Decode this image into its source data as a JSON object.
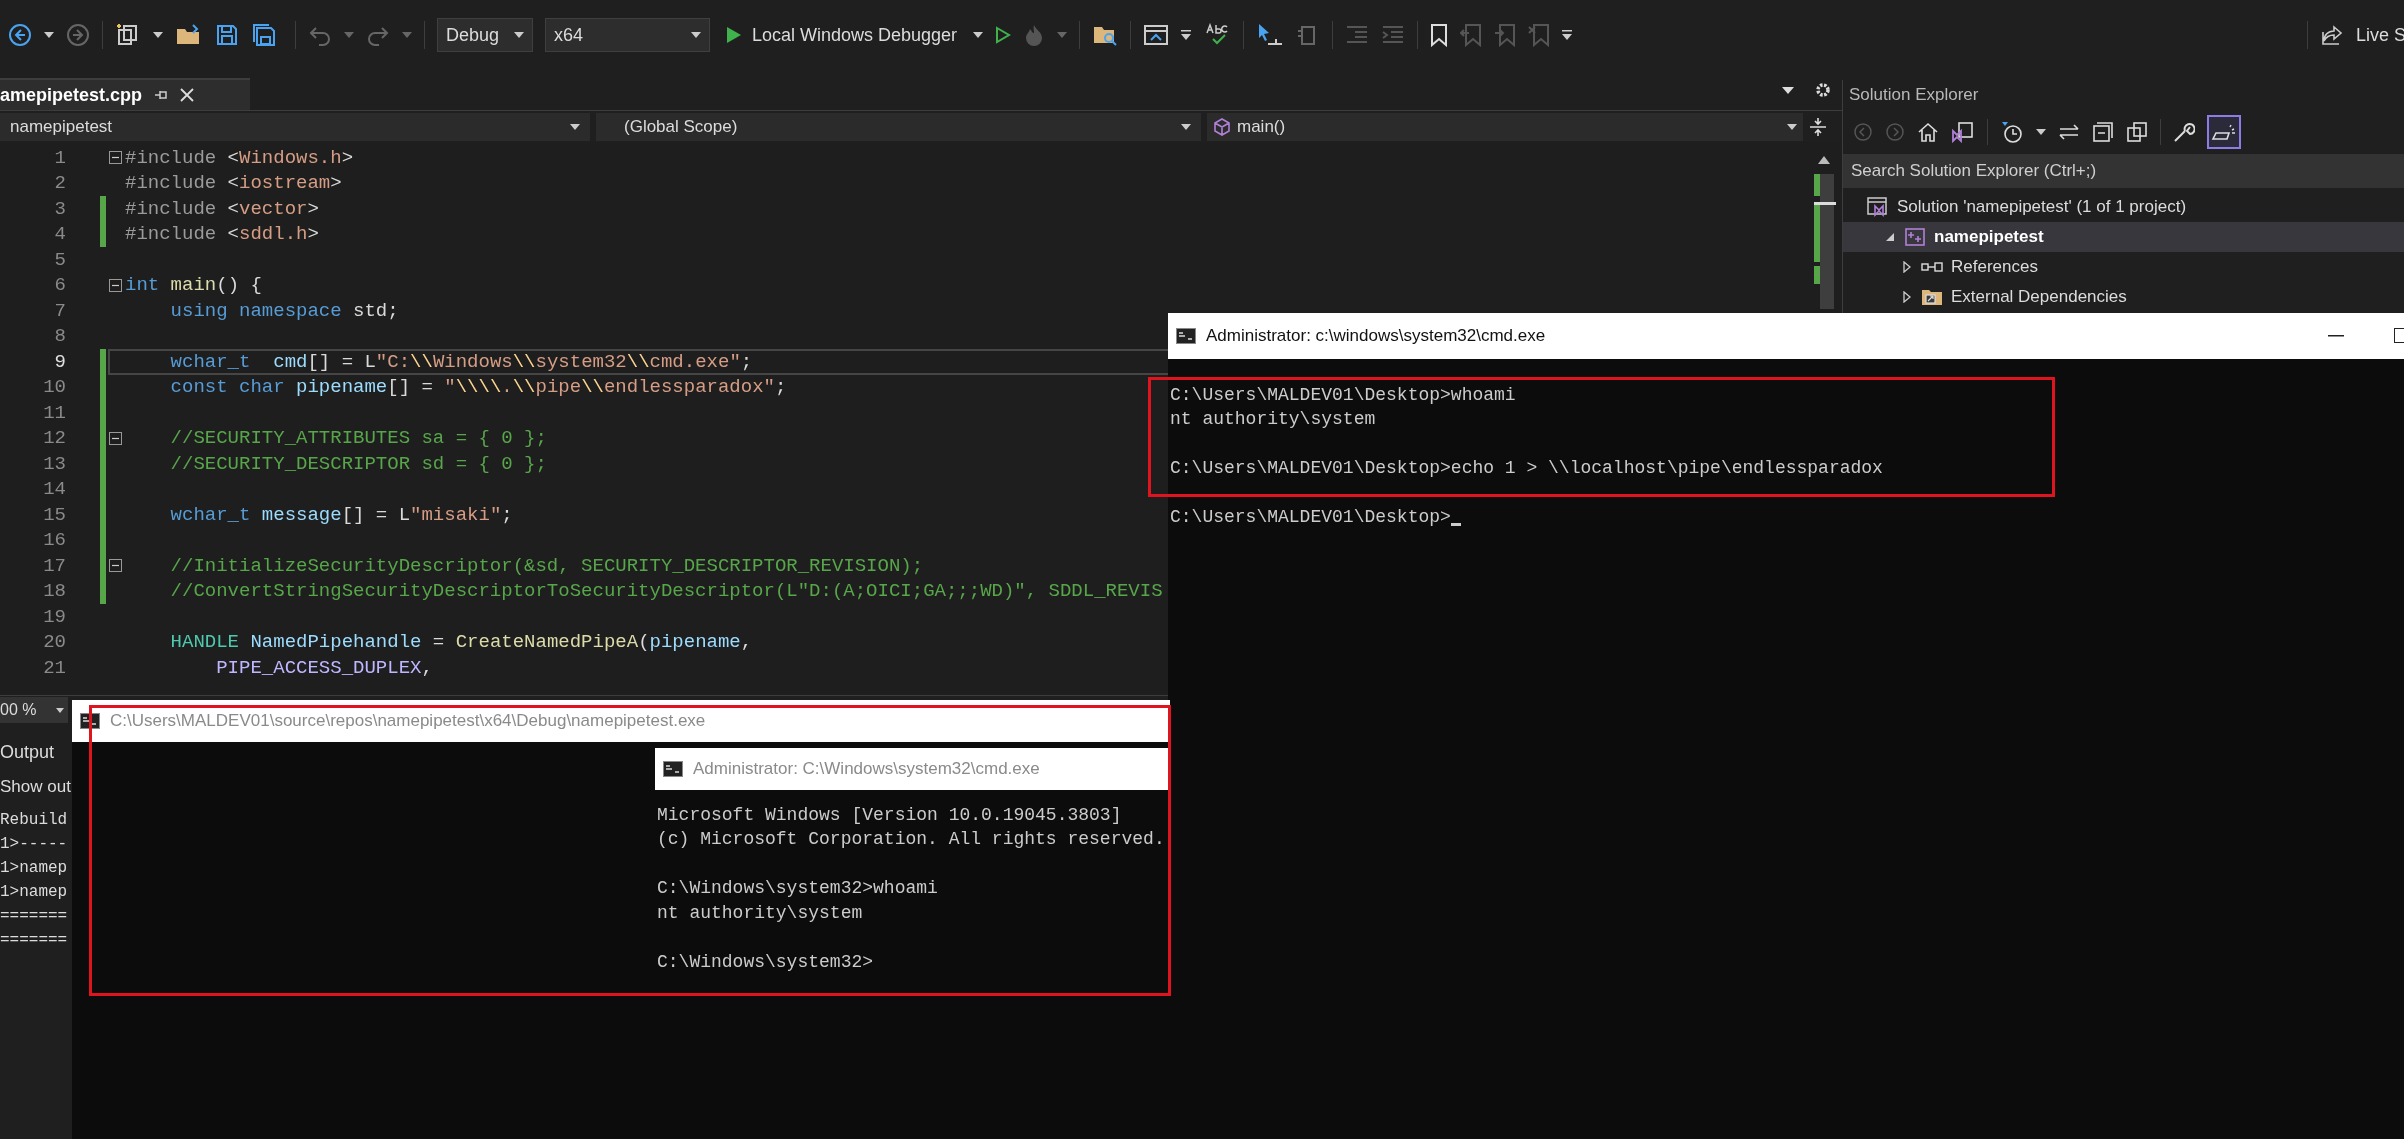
{
  "toolbar": {
    "configuration": "Debug",
    "platform": "x64",
    "debugger": "Local Windows Debugger",
    "live_share": "Live S"
  },
  "editor": {
    "tab": "amepipetest.cpp",
    "nav": {
      "project": "namepipetest",
      "scope": "(Global Scope)",
      "member": "main()"
    },
    "lines": [
      {
        "number": "1",
        "changed": false,
        "fold": true,
        "current": false,
        "tokens": [
          {
            "text": "#include",
            "kind": "pre"
          },
          {
            "text": " <",
            "kind": "plain"
          },
          {
            "text": "Windows.h",
            "kind": "str"
          },
          {
            "text": ">",
            "kind": "plain"
          }
        ]
      },
      {
        "number": "2",
        "changed": false,
        "fold": false,
        "current": false,
        "tokens": [
          {
            "text": "#include",
            "kind": "pre"
          },
          {
            "text": " <",
            "kind": "plain"
          },
          {
            "text": "iostream",
            "kind": "str"
          },
          {
            "text": ">",
            "kind": "plain"
          }
        ]
      },
      {
        "number": "3",
        "changed": true,
        "fold": false,
        "current": false,
        "tokens": [
          {
            "text": "#include",
            "kind": "pre"
          },
          {
            "text": " <",
            "kind": "plain"
          },
          {
            "text": "vector",
            "kind": "str"
          },
          {
            "text": ">",
            "kind": "plain"
          }
        ]
      },
      {
        "number": "4",
        "changed": true,
        "fold": false,
        "current": false,
        "tokens": [
          {
            "text": "#include",
            "kind": "pre"
          },
          {
            "text": " <",
            "kind": "plain"
          },
          {
            "text": "sddl.h",
            "kind": "str"
          },
          {
            "text": ">",
            "kind": "plain"
          }
        ]
      },
      {
        "number": "5",
        "changed": false,
        "fold": false,
        "current": false
      },
      {
        "number": "6",
        "changed": false,
        "fold": true,
        "current": false,
        "tokens": [
          {
            "text": "int",
            "kind": "kw"
          },
          {
            "text": " main",
            "kind": "func"
          },
          {
            "text": "() {",
            "kind": "plain"
          }
        ]
      },
      {
        "number": "7",
        "changed": false,
        "fold": false,
        "current": false,
        "tokens": [
          {
            "text": "    using namespace",
            "kind": "kw"
          },
          {
            "text": " std;",
            "kind": "plain"
          }
        ]
      },
      {
        "number": "8",
        "changed": false,
        "fold": false,
        "current": false
      },
      {
        "number": "9",
        "changed": true,
        "fold": false,
        "current": true,
        "tokens": [
          {
            "text": "    wchar_t",
            "kind": "kw"
          },
          {
            "text": "  cmd",
            "kind": "var"
          },
          {
            "text": "[] = L",
            "kind": "plain"
          },
          {
            "text": "\"C:",
            "kind": "str"
          },
          {
            "text": "\\\\",
            "kind": "esc"
          },
          {
            "text": "Windows",
            "kind": "str"
          },
          {
            "text": "\\\\",
            "kind": "esc"
          },
          {
            "text": "system32",
            "kind": "str"
          },
          {
            "text": "\\\\",
            "kind": "esc"
          },
          {
            "text": "cmd.exe\"",
            "kind": "str"
          },
          {
            "text": ";",
            "kind": "plain"
          }
        ]
      },
      {
        "number": "10",
        "changed": true,
        "fold": false,
        "current": false,
        "tokens": [
          {
            "text": "    const char",
            "kind": "kw"
          },
          {
            "text": " pipename",
            "kind": "var"
          },
          {
            "text": "[] = ",
            "kind": "plain"
          },
          {
            "text": "\"",
            "kind": "str"
          },
          {
            "text": "\\\\\\\\",
            "kind": "esc"
          },
          {
            "text": ".",
            "kind": "str"
          },
          {
            "text": "\\\\",
            "kind": "esc"
          },
          {
            "text": "pipe",
            "kind": "str"
          },
          {
            "text": "\\\\",
            "kind": "esc"
          },
          {
            "text": "endlessparadox\"",
            "kind": "str"
          },
          {
            "text": ";",
            "kind": "plain"
          }
        ]
      },
      {
        "number": "11",
        "changed": true,
        "fold": false,
        "current": false
      },
      {
        "number": "12",
        "changed": true,
        "fold": true,
        "current": false,
        "tokens": [
          {
            "text": "    //SECURITY_ATTRIBUTES sa = { 0 };",
            "kind": "com"
          }
        ]
      },
      {
        "number": "13",
        "changed": true,
        "fold": false,
        "current": false,
        "tokens": [
          {
            "text": "    //SECURITY_DESCRIPTOR sd = { 0 };",
            "kind": "com"
          }
        ]
      },
      {
        "number": "14",
        "changed": true,
        "fold": false,
        "current": false
      },
      {
        "number": "15",
        "changed": true,
        "fold": false,
        "current": false,
        "tokens": [
          {
            "text": "    wchar_t",
            "kind": "kw"
          },
          {
            "text": " message",
            "kind": "var"
          },
          {
            "text": "[] = L",
            "kind": "plain"
          },
          {
            "text": "\"misaki\"",
            "kind": "str"
          },
          {
            "text": ";",
            "kind": "plain"
          }
        ]
      },
      {
        "number": "16",
        "changed": true,
        "fold": false,
        "current": false
      },
      {
        "number": "17",
        "changed": true,
        "fold": true,
        "current": false,
        "tokens": [
          {
            "text": "    //InitializeSecurityDescriptor(&sd, SECURITY_DESCRIPTOR_REVISION);",
            "kind": "com"
          }
        ]
      },
      {
        "number": "18",
        "changed": true,
        "fold": false,
        "current": false,
        "tokens": [
          {
            "text": "    //ConvertStringSecurityDescriptorToSecurityDescriptor(L\"D:(A;OICI;GA;;;WD)\", SDDL_REVIS",
            "kind": "com"
          }
        ]
      },
      {
        "number": "19",
        "changed": false,
        "fold": false,
        "current": false
      },
      {
        "number": "20",
        "changed": false,
        "fold": false,
        "current": false,
        "tokens": [
          {
            "text": "    HANDLE",
            "kind": "type"
          },
          {
            "text": " NamedPipehandle",
            "kind": "var"
          },
          {
            "text": " = ",
            "kind": "plain"
          },
          {
            "text": "CreateNamedPipeA",
            "kind": "func"
          },
          {
            "text": "(",
            "kind": "plain"
          },
          {
            "text": "pipename",
            "kind": "var"
          },
          {
            "text": ",",
            "kind": "plain"
          }
        ]
      },
      {
        "number": "21",
        "changed": false,
        "fold": false,
        "current": false,
        "tokens": [
          {
            "text": "        PIPE_ACCESS_DUPLEX",
            "kind": "mac"
          },
          {
            "text": ",",
            "kind": "plain"
          }
        ]
      }
    ]
  },
  "output_panel": {
    "zoom": "00 %",
    "title": "Output",
    "show_output_from": "Show out",
    "lines": [
      "Rebuild",
      "1>-----",
      "1>namep",
      "1>namep",
      "=======",
      "======="
    ]
  },
  "solution_explorer": {
    "title": "Solution Explorer",
    "preview_toggle_on": true,
    "search": {
      "placeholder": "Search Solution Explorer (Ctrl+;)"
    },
    "tree": [
      {
        "label": "Solution 'namepipetest' (1 of 1 project)",
        "kind": "solution",
        "selected": false,
        "children": [
          {
            "label": "namepipetest",
            "kind": "project",
            "selected": true,
            "expanded": true,
            "children": [
              {
                "label": "References",
                "kind": "references",
                "selected": false,
                "expanded": false
              },
              {
                "label": "External Dependencies",
                "kind": "folder",
                "selected": false,
                "expanded": false
              }
            ]
          }
        ]
      }
    ]
  },
  "windows": [
    {
      "title": "Administrator: c:\\windows\\system32\\cmd.exe",
      "active": true,
      "cursor": true,
      "blocks": [
        [
          "C:\\Users\\MALDEV01\\Desktop>whoami",
          "nt authority\\system"
        ],
        [
          "C:\\Users\\MALDEV01\\Desktop>echo 1 > \\\\localhost\\pipe\\endlessparadox"
        ],
        [
          "C:\\Users\\MALDEV01\\Desktop>"
        ]
      ]
    },
    {
      "title": "C:\\Users\\MALDEV01\\source\\repos\\namepipetest\\x64\\Debug\\namepipetest.exe",
      "active": false
    },
    {
      "title": "Administrator: C:\\Windows\\system32\\cmd.exe",
      "active": false,
      "cursor": false,
      "blocks": [
        [
          "Microsoft Windows [Version 10.0.19045.3803]",
          "(c) Microsoft Corporation. All rights reserved."
        ],
        [
          "C:\\Windows\\system32>whoami",
          "nt authority\\system"
        ],
        [
          "C:\\Windows\\system32>"
        ]
      ]
    }
  ]
}
